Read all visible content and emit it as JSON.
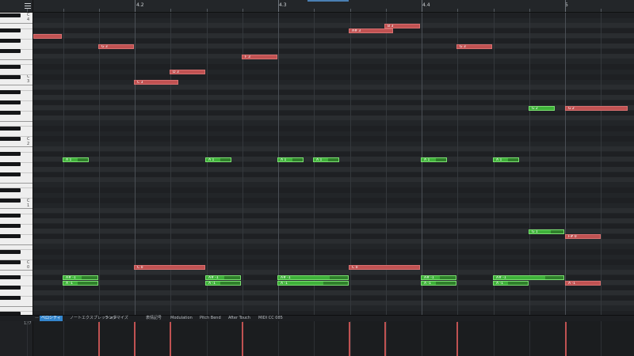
{
  "toolbar": {
    "menu_icon": "hamburger-menu-icon"
  },
  "ruler": {
    "labels": [
      "4.2",
      "4.3",
      "4.4",
      "5"
    ]
  },
  "keyboard": {
    "octave_labels": [
      "C 4",
      "C 3",
      "C 2",
      "C 1",
      "C 0"
    ]
  },
  "notes": [
    {
      "label": "",
      "color": "red"
    },
    {
      "label": "G 3",
      "color": "red"
    },
    {
      "label": "C 3",
      "color": "red"
    },
    {
      "label": "D 3",
      "color": "red"
    },
    {
      "label": "F 3",
      "color": "red"
    },
    {
      "label": "A# 3",
      "color": "red"
    },
    {
      "label": "B 3",
      "color": "red"
    },
    {
      "label": "G 3",
      "color": "red"
    },
    {
      "label": "G 2",
      "color": "green"
    },
    {
      "label": "G 2",
      "color": "red"
    },
    {
      "label": "A 1",
      "color": "green"
    },
    {
      "label": "A 1",
      "color": "green"
    },
    {
      "label": "A 1",
      "color": "green"
    },
    {
      "label": "A 1",
      "color": "green"
    },
    {
      "label": "A 1",
      "color": "green"
    },
    {
      "label": "A 1",
      "color": "green"
    },
    {
      "label": "G 1",
      "color": "green"
    },
    {
      "label": "F# 0",
      "color": "red"
    },
    {
      "label": "C 0",
      "color": "red"
    },
    {
      "label": "C 0",
      "color": "red"
    },
    {
      "label": "A# -1",
      "color": "green"
    },
    {
      "label": "A -1",
      "color": "green"
    },
    {
      "label": "A# -1",
      "color": "green"
    },
    {
      "label": "A -1",
      "color": "green"
    },
    {
      "label": "A# -1",
      "color": "green"
    },
    {
      "label": "A -1",
      "color": "green"
    },
    {
      "label": "A# -1",
      "color": "green"
    },
    {
      "label": "A -1",
      "color": "green"
    },
    {
      "label": "A# -1",
      "color": "green"
    },
    {
      "label": "A -1",
      "color": "green"
    },
    {
      "label": "A -1",
      "color": "red"
    }
  ],
  "tabs": {
    "dash": "—",
    "items": [
      "ベロシティ",
      "ノートエクスプレッション",
      "ランダマイズ",
      "表情記号",
      "Modulation",
      "Pitch Bend",
      "After Touch",
      "MIDI CC 085"
    ],
    "active": "ベロシティ"
  },
  "velocity": {
    "max_label": "127"
  },
  "colors": {
    "note_red": "#c05252",
    "note_green": "#3fb13a",
    "accent": "#3385cc"
  }
}
